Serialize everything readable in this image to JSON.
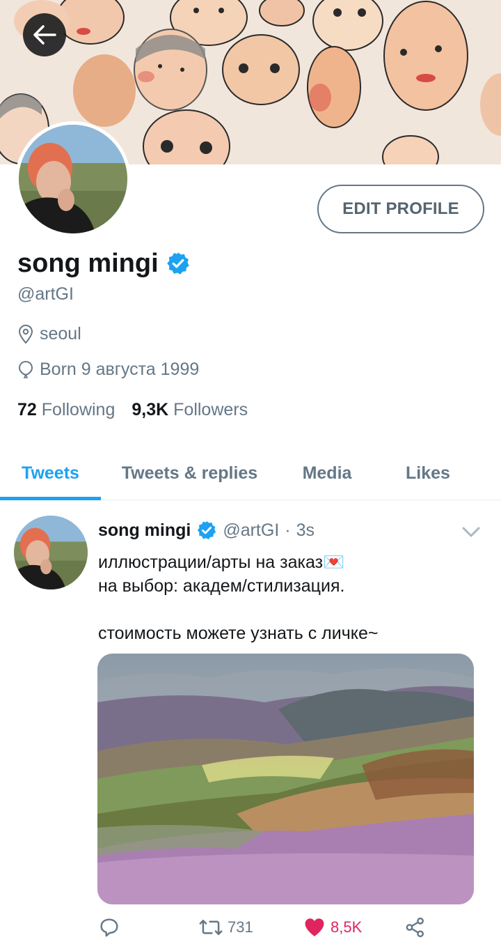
{
  "profile": {
    "name": "song mingi",
    "handle": "@artGI",
    "location": "seoul",
    "birth": "Born 9 августа 1999",
    "edit_label": "EDIT PROFILE",
    "following_count": "72",
    "following_label": "Following",
    "followers_count": "9,3K",
    "followers_label": "Followers",
    "verified": true
  },
  "tabs": [
    {
      "label": "Tweets",
      "active": true
    },
    {
      "label": "Tweets & replies",
      "active": false
    },
    {
      "label": "Media",
      "active": false
    },
    {
      "label": "Likes",
      "active": false
    }
  ],
  "tweet": {
    "name": "song mingi",
    "handle": "@artGI",
    "separator": "·",
    "time": "3s",
    "text": "иллюстрации/арты на заказ💌\nна выбор: академ/стилизация.\n\nстоимость можете узнать с личке~",
    "retweets": "731",
    "likes": "8,5K"
  },
  "icons": {
    "back": "arrow-left-icon",
    "verified": "verified-badge-icon",
    "location": "location-pin-icon",
    "birth": "balloon-icon",
    "more": "chevron-down-icon",
    "reply": "reply-icon",
    "retweet": "retweet-icon",
    "like": "heart-icon",
    "share": "share-icon"
  },
  "colors": {
    "accent": "#1da1f2",
    "secondary_text": "#657786",
    "like": "#e0245e"
  }
}
